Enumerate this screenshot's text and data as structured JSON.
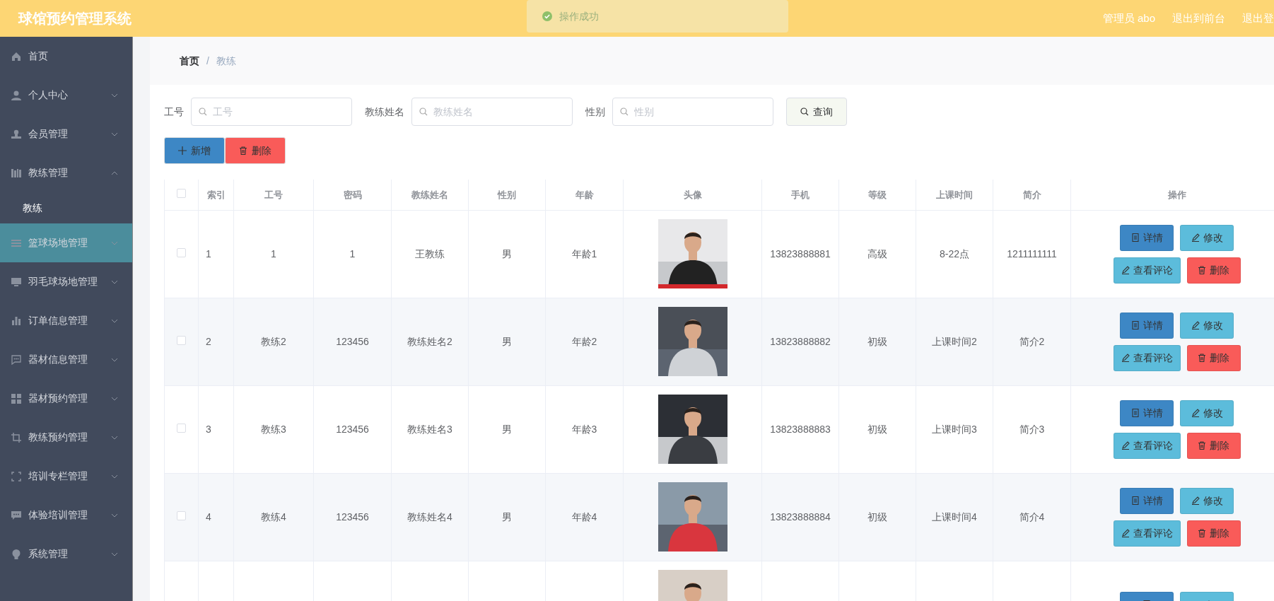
{
  "header": {
    "title": "球馆预约管理系统",
    "toast": {
      "text": "操作成功",
      "kind": "success"
    },
    "user": "管理员 abo",
    "links": [
      "退出到前台",
      "退出登"
    ]
  },
  "sidebar": {
    "items": [
      {
        "label": "首页",
        "kind": "link",
        "selected": false,
        "expanded": false
      },
      {
        "label": "个人中心",
        "kind": "menu",
        "selected": false,
        "expanded": false
      },
      {
        "label": "会员管理",
        "kind": "menu",
        "selected": false,
        "expanded": false
      },
      {
        "label": "教练管理",
        "kind": "menu",
        "selected": false,
        "expanded": true,
        "children": [
          {
            "label": "教练",
            "selected": true
          }
        ]
      },
      {
        "label": "篮球场地管理",
        "kind": "menu",
        "selected": true,
        "expanded": false
      },
      {
        "label": "羽毛球场地管理",
        "kind": "menu",
        "selected": false,
        "expanded": false
      },
      {
        "label": "订单信息管理",
        "kind": "menu",
        "selected": false,
        "expanded": false
      },
      {
        "label": "器材信息管理",
        "kind": "menu",
        "selected": false,
        "expanded": false
      },
      {
        "label": "器材预约管理",
        "kind": "menu",
        "selected": false,
        "expanded": false
      },
      {
        "label": "教练预约管理",
        "kind": "menu",
        "selected": false,
        "expanded": false
      },
      {
        "label": "培训专栏管理",
        "kind": "menu",
        "selected": false,
        "expanded": false
      },
      {
        "label": "体验培训管理",
        "kind": "menu",
        "selected": false,
        "expanded": false
      },
      {
        "label": "系统管理",
        "kind": "menu",
        "selected": false,
        "expanded": false
      }
    ]
  },
  "breadcrumb": {
    "items": [
      "首页",
      "教练"
    ],
    "separator": "/"
  },
  "search": {
    "fields": [
      {
        "label": "工号",
        "placeholder": "工号"
      },
      {
        "label": "教练姓名",
        "placeholder": "教练姓名"
      },
      {
        "label": "性别",
        "placeholder": "性别"
      }
    ],
    "button": "查询"
  },
  "toolbar": [
    {
      "label": "新增",
      "kind": "add"
    },
    {
      "label": "删除",
      "kind": "delete"
    }
  ],
  "table": {
    "select_all": false,
    "columns": [
      "索引",
      "工号",
      "密码",
      "教练姓名",
      "性别",
      "年龄",
      "头像",
      "手机",
      "等级",
      "上课时间",
      "简介",
      "操作"
    ],
    "rows": [
      {
        "checked": false,
        "cells": [
          "1",
          "1",
          "1",
          "王教练",
          "男",
          "年龄1",
          "13823888881",
          "高级",
          "8-22点",
          "1211111111"
        ],
        "photo": {
          "kind": "picture"
        },
        "actions": [
          {
            "label": "详情",
            "kind": "detail"
          },
          {
            "label": "修改",
            "kind": "edit"
          },
          {
            "label": "查看评论",
            "kind": "comment"
          },
          {
            "label": "删除",
            "kind": "delete"
          }
        ]
      },
      {
        "checked": false,
        "cells": [
          "2",
          "教练2",
          "123456",
          "教练姓名2",
          "男",
          "年龄2",
          "13823888882",
          "初级",
          "上课时间2",
          "简介2"
        ],
        "photo": {
          "kind": "picture"
        },
        "actions": [
          {
            "label": "详情",
            "kind": "detail"
          },
          {
            "label": "修改",
            "kind": "edit"
          },
          {
            "label": "查看评论",
            "kind": "comment"
          },
          {
            "label": "删除",
            "kind": "delete"
          }
        ]
      },
      {
        "checked": false,
        "cells": [
          "3",
          "教练3",
          "123456",
          "教练姓名3",
          "男",
          "年龄3",
          "13823888883",
          "初级",
          "上课时间3",
          "简介3"
        ],
        "photo": {
          "kind": "picture"
        },
        "actions": [
          {
            "label": "详情",
            "kind": "detail"
          },
          {
            "label": "修改",
            "kind": "edit"
          },
          {
            "label": "查看评论",
            "kind": "comment"
          },
          {
            "label": "删除",
            "kind": "delete"
          }
        ]
      },
      {
        "checked": false,
        "cells": [
          "4",
          "教练4",
          "123456",
          "教练姓名4",
          "男",
          "年龄4",
          "13823888884",
          "初级",
          "上课时间4",
          "简介4"
        ],
        "photo": {
          "kind": "picture"
        },
        "actions": [
          {
            "label": "详情",
            "kind": "detail"
          },
          {
            "label": "修改",
            "kind": "edit"
          },
          {
            "label": "查看评论",
            "kind": "comment"
          },
          {
            "label": "删除",
            "kind": "delete"
          }
        ]
      },
      {
        "photo": {
          "kind": "picture"
        },
        "actions": [
          {
            "kind": "detail"
          },
          {
            "kind": "edit"
          }
        ]
      }
    ]
  }
}
